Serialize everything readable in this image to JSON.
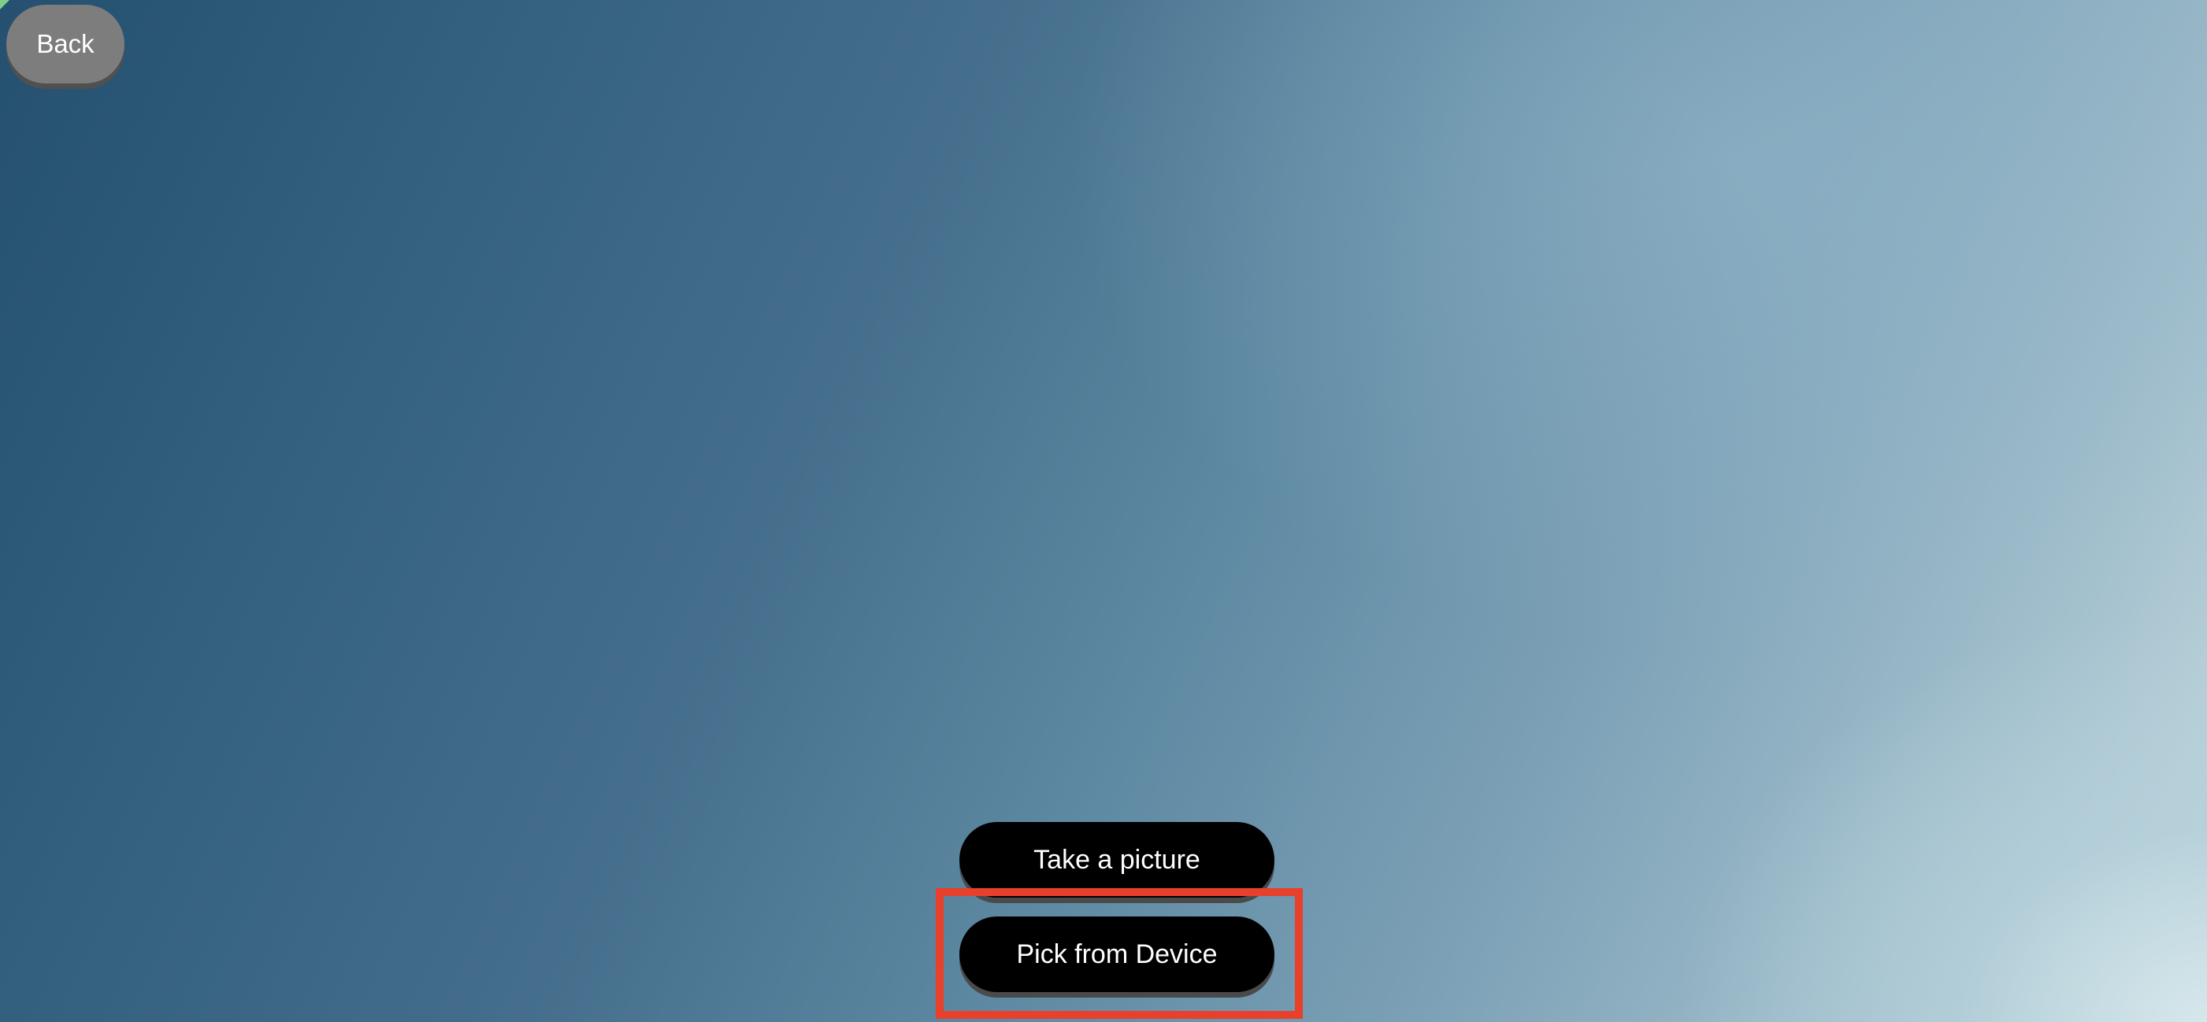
{
  "screen": {
    "background": "sky-photo"
  },
  "nav": {
    "back_label": "Back"
  },
  "actions": {
    "take_picture_label": "Take a picture",
    "pick_from_device_label": "Pick from Device"
  },
  "colors": {
    "back_button": "#7d7d7d",
    "action_button": "#000000",
    "button_text": "#ffffff",
    "highlight": "#e8402a"
  }
}
